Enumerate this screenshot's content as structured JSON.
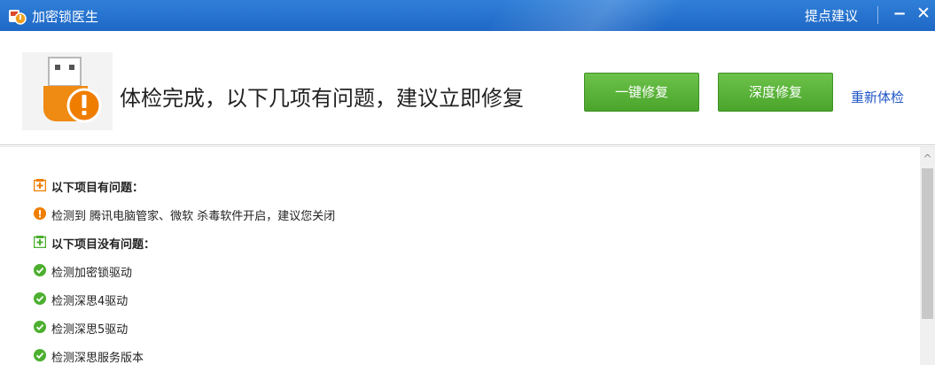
{
  "window": {
    "title": "加密锁医生",
    "feedback": "提点建议",
    "minimize": "−",
    "close": "✕"
  },
  "header": {
    "headline": "体检完成，以下几项有问题，建议立即修复",
    "btn_one_click": "一键修复",
    "btn_deep": "深度修复",
    "recheck": "重新体检"
  },
  "results": {
    "problem_heading": "以下项目有问题：",
    "problems": [
      "检测到 腾讯电脑管家、微软 杀毒软件开启，建议您关闭"
    ],
    "ok_heading": "以下项目没有问题：",
    "ok_items": [
      "检测加密锁驱动",
      "检测深思4驱动",
      "检测深思5驱动",
      "检测深思服务版本"
    ]
  },
  "colors": {
    "titlebar": "#2270cc",
    "button_green": "#5bb43a",
    "link_blue": "#1f56c4",
    "warn_orange": "#f07d00",
    "ok_green": "#4caf2f"
  }
}
